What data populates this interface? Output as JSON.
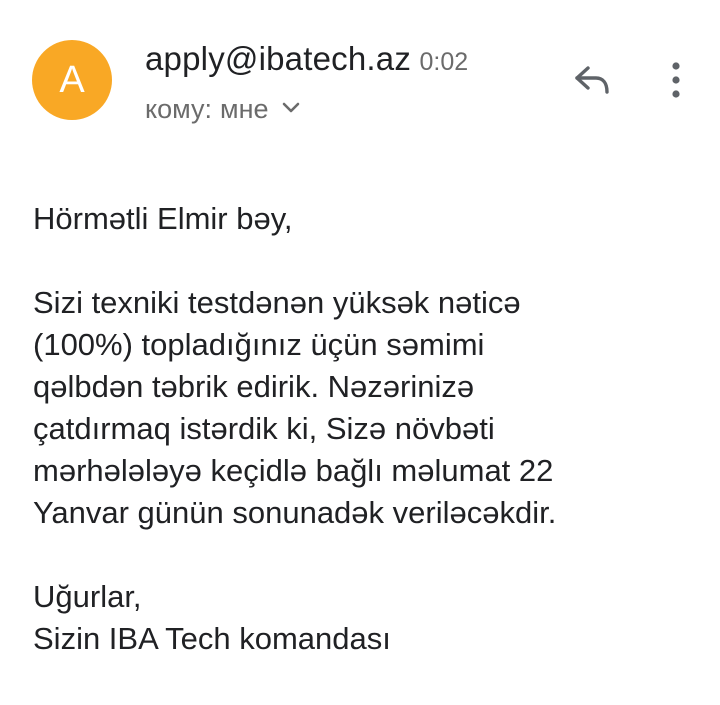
{
  "header": {
    "avatar_letter": "A",
    "avatar_color": "#f9a825",
    "sender": "apply@ibatech.az",
    "time": "0:02",
    "to_label": "кому:",
    "recipient": "мне",
    "icons": {
      "chevron": "chevron-down-icon",
      "reply": "reply-icon",
      "more": "more-vert-icon"
    }
  },
  "message": {
    "greeting": "Hörmətli Elmir bəy,",
    "lines": [
      "Sizi texniki testdənən yüksək nəticə",
      "(100%) topladığınız üçün səmimi",
      "qəlbdən təbrik edirik. Nəzərinizə",
      "çatdırmaq istərdik ki, Sizə növbəti",
      "mərhələləyə keçidlə bağlı məlumat 22",
      "Yanvar günün sonunadək veriləcəkdir."
    ],
    "closing": "Uğurlar,",
    "signature": "Sizin IBA Tech komandası"
  }
}
